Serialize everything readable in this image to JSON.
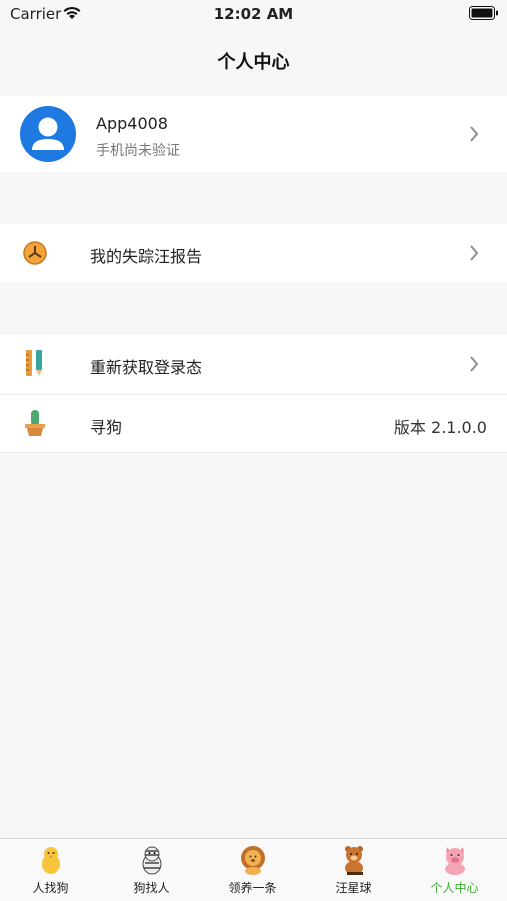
{
  "status_bar": {
    "carrier": "Carrier",
    "time": "12:02 AM"
  },
  "nav": {
    "title": "个人中心"
  },
  "profile": {
    "name": "App4008",
    "subtitle": "手机尚未验证"
  },
  "menu": {
    "report": {
      "label": "我的失踪汪报告",
      "icon": "clock-icon"
    },
    "relogin": {
      "label": "重新获取登录态",
      "icon": "tools-icon"
    },
    "search": {
      "label": "寻狗",
      "value": "版本 2.1.0.0",
      "icon": "cactus-icon"
    }
  },
  "tabs": [
    {
      "label": "人找狗",
      "icon": "chick-icon"
    },
    {
      "label": "狗找人",
      "icon": "zebra-icon"
    },
    {
      "label": "领养一条",
      "icon": "lion-icon"
    },
    {
      "label": "汪星球",
      "icon": "bear-icon"
    },
    {
      "label": "个人中心",
      "icon": "pig-icon",
      "active": true
    }
  ],
  "colors": {
    "active_tab": "#3cb034",
    "avatar": "#1e7ae0",
    "background": "#f7f7f7"
  }
}
